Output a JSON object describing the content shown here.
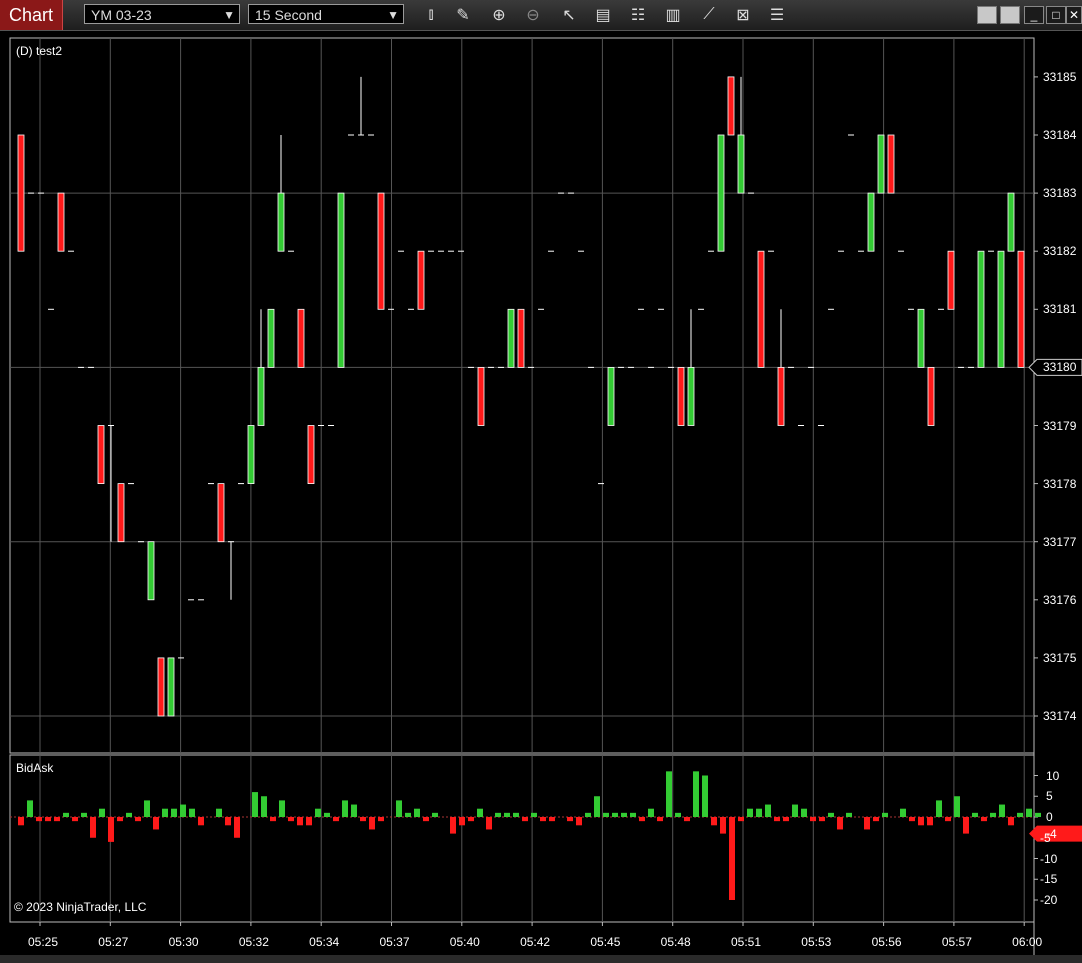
{
  "toolbar": {
    "chart_label": "Chart",
    "instrument": "YM 03-23",
    "interval": "15 Second",
    "icons": [
      "bar-type-icon",
      "pencil-icon",
      "zoom-in-icon",
      "zoom-out-icon",
      "pointer-icon",
      "data-box-icon",
      "properties-icon",
      "indicators-icon",
      "strategies-icon",
      "templates-icon",
      "list-icon"
    ]
  },
  "panel_main": {
    "title": "(D) test2"
  },
  "panel_sub": {
    "title": "BidAsk",
    "copyright": "© 2023 NinjaTrader, LLC"
  },
  "current_price": "33180",
  "current_bidask": "-4",
  "colors": {
    "up": "#33cc33",
    "down": "#ff1a1a",
    "grid": "#555555",
    "price_marker_bg": "#000000",
    "bidask_marker_bg": "#ff1a1a"
  },
  "chart_data": [
    {
      "type": "candlestick",
      "title": "(D) test2",
      "y_ticks": [
        33174,
        33175,
        33176,
        33177,
        33178,
        33179,
        33180,
        33181,
        33182,
        33183,
        33184,
        33185
      ],
      "ylim": [
        33173.8,
        33185.3
      ],
      "x_tick_labels": [
        "05:25",
        "05:27",
        "05:30",
        "05:32",
        "05:34",
        "05:37",
        "05:40",
        "05:42",
        "05:45",
        "05:48",
        "05:51",
        "05:53",
        "05:56",
        "05:57",
        "06:00"
      ],
      "bars": [
        [
          33184,
          33184,
          33182,
          33182
        ],
        [
          33183,
          33183,
          33183,
          33183
        ],
        [
          33183,
          33183,
          33183,
          33183
        ],
        [
          33181,
          33181,
          33181,
          33181
        ],
        [
          33183,
          33183,
          33182,
          33182
        ],
        [
          33182,
          33182,
          33182,
          33182
        ],
        [
          33180,
          33180,
          33180,
          33180
        ],
        [
          33180,
          33180,
          33180,
          33180
        ],
        [
          33179,
          33179,
          33178,
          33178
        ],
        [
          33179,
          33179,
          33177,
          33179
        ],
        [
          33178,
          33178,
          33177,
          33177
        ],
        [
          33178,
          33178,
          33178,
          33178
        ],
        [
          33177,
          33177,
          33177,
          33177
        ],
        [
          33176,
          33177,
          33176,
          33177
        ],
        [
          33175,
          33175,
          33174,
          33174
        ],
        [
          33174,
          33175,
          33174,
          33175
        ],
        [
          33175,
          33175,
          33175,
          33175
        ],
        [
          33176,
          33176,
          33176,
          33176
        ],
        [
          33176,
          33176,
          33176,
          33176
        ],
        [
          33178,
          33178,
          33178,
          33178
        ],
        [
          33178,
          33178,
          33177,
          33177
        ],
        [
          33177,
          33177,
          33176,
          33177
        ],
        [
          33178,
          33178,
          33178,
          33178
        ],
        [
          33178,
          33179,
          33178,
          33179
        ],
        [
          33179,
          33181,
          33179,
          33180
        ],
        [
          33180,
          33181,
          33180,
          33181
        ],
        [
          33182,
          33184,
          33182,
          33183
        ],
        [
          33182,
          33182,
          33182,
          33182
        ],
        [
          33181,
          33181,
          33180,
          33180
        ],
        [
          33179,
          33179,
          33178,
          33178
        ],
        [
          33179,
          33179,
          33179,
          33179
        ],
        [
          33179,
          33179,
          33179,
          33179
        ],
        [
          33180,
          33183,
          33180,
          33183
        ],
        [
          33184,
          33184,
          33184,
          33184
        ],
        [
          33184,
          33185,
          33184,
          33184
        ],
        [
          33184,
          33184,
          33184,
          33184
        ],
        [
          33183,
          33183,
          33181,
          33181
        ],
        [
          33181,
          33181,
          33181,
          33181
        ],
        [
          33182,
          33182,
          33182,
          33182
        ],
        [
          33181,
          33181,
          33181,
          33181
        ],
        [
          33182,
          33182,
          33181,
          33181
        ],
        [
          33182,
          33182,
          33182,
          33182
        ],
        [
          33182,
          33182,
          33182,
          33182
        ],
        [
          33182,
          33182,
          33182,
          33182
        ],
        [
          33182,
          33182,
          33182,
          33182
        ],
        [
          33180,
          33180,
          33180,
          33180
        ],
        [
          33180,
          33180,
          33179,
          33179
        ],
        [
          33180,
          33180,
          33180,
          33180
        ],
        [
          33180,
          33180,
          33180,
          33180
        ],
        [
          33180,
          33181,
          33180,
          33181
        ],
        [
          33181,
          33181,
          33180,
          33180
        ],
        [
          33180,
          33180,
          33180,
          33180
        ],
        [
          33181,
          33181,
          33181,
          33181
        ],
        [
          33182,
          33182,
          33182,
          33182
        ],
        [
          33183,
          33183,
          33183,
          33183
        ],
        [
          33183,
          33183,
          33183,
          33183
        ],
        [
          33182,
          33182,
          33182,
          33182
        ],
        [
          33180,
          33180,
          33180,
          33180
        ],
        [
          33178,
          33178,
          33178,
          33178
        ],
        [
          33179,
          33180,
          33179,
          33180
        ],
        [
          33180,
          33180,
          33180,
          33180
        ],
        [
          33180,
          33180,
          33180,
          33180
        ],
        [
          33181,
          33181,
          33181,
          33181
        ],
        [
          33180,
          33180,
          33180,
          33180
        ],
        [
          33181,
          33181,
          33181,
          33181
        ],
        [
          33180,
          33180,
          33180,
          33180
        ],
        [
          33180,
          33180,
          33179,
          33179
        ],
        [
          33179,
          33181,
          33179,
          33180
        ],
        [
          33181,
          33181,
          33181,
          33181
        ],
        [
          33182,
          33182,
          33182,
          33182
        ],
        [
          33182,
          33184,
          33182,
          33184
        ],
        [
          33185,
          33185,
          33184,
          33184
        ],
        [
          33183,
          33185,
          33183,
          33184
        ],
        [
          33183,
          33183,
          33183,
          33183
        ],
        [
          33182,
          33182,
          33180,
          33180
        ],
        [
          33182,
          33182,
          33182,
          33182
        ],
        [
          33180,
          33181,
          33179,
          33179
        ],
        [
          33180,
          33180,
          33180,
          33180
        ],
        [
          33179,
          33179,
          33179,
          33179
        ],
        [
          33180,
          33180,
          33180,
          33180
        ],
        [
          33179,
          33179,
          33179,
          33179
        ],
        [
          33181,
          33181,
          33181,
          33181
        ],
        [
          33182,
          33182,
          33182,
          33182
        ],
        [
          33184,
          33184,
          33184,
          33184
        ],
        [
          33182,
          33182,
          33182,
          33182
        ],
        [
          33182,
          33183,
          33182,
          33183
        ],
        [
          33183,
          33184,
          33183,
          33184
        ],
        [
          33184,
          33184,
          33183,
          33183
        ],
        [
          33182,
          33182,
          33182,
          33182
        ],
        [
          33181,
          33181,
          33181,
          33181
        ],
        [
          33180,
          33181,
          33180,
          33181
        ],
        [
          33180,
          33180,
          33179,
          33179
        ],
        [
          33181,
          33181,
          33181,
          33181
        ],
        [
          33182,
          33182,
          33181,
          33181
        ],
        [
          33180,
          33180,
          33180,
          33180
        ],
        [
          33180,
          33180,
          33180,
          33180
        ],
        [
          33180,
          33182,
          33180,
          33182
        ],
        [
          33182,
          33182,
          33182,
          33182
        ],
        [
          33180,
          33182,
          33180,
          33182
        ],
        [
          33182,
          33183,
          33182,
          33183
        ],
        [
          33182,
          33182,
          33180,
          33180
        ]
      ]
    },
    {
      "type": "bar",
      "title": "BidAsk",
      "y_ticks": [
        10,
        5,
        0,
        -5,
        -10,
        -15,
        -20
      ],
      "ylim": [
        -22,
        12
      ],
      "values": [
        -2,
        4,
        -1,
        -1,
        -1,
        1,
        -1,
        1,
        -5,
        2,
        -6,
        -1,
        1,
        -1,
        4,
        -3,
        2,
        2,
        3,
        2,
        -2,
        0,
        2,
        -2,
        -5,
        0,
        6,
        5,
        -1,
        4,
        -1,
        -2,
        -2,
        2,
        1,
        -1,
        4,
        3,
        -1,
        -3,
        -1,
        0,
        4,
        1,
        2,
        -1,
        1,
        0,
        -4,
        -2,
        -1,
        2,
        -3,
        1,
        1,
        1,
        -1,
        1,
        -1,
        -1,
        0,
        -1,
        -2,
        1,
        5,
        1,
        1,
        1,
        1,
        -1,
        2,
        -1,
        11,
        1,
        -1,
        11,
        10,
        -2,
        -4,
        -20,
        -1,
        2,
        2,
        3,
        -1,
        -1,
        3,
        2,
        -1,
        -1,
        1,
        -3,
        1,
        0,
        -3,
        -1,
        1,
        0,
        2,
        -1,
        -2,
        -2,
        4,
        -1,
        5,
        -4,
        1,
        -1,
        1,
        3,
        -2,
        1,
        2,
        1
      ]
    }
  ]
}
